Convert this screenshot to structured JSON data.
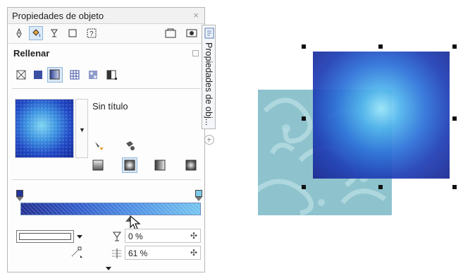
{
  "panel": {
    "title": "Propiedades de objeto",
    "close_glyph": "×",
    "toolbar_icons": [
      "pen-nib-icon",
      "fill-bucket-icon",
      "transparency-glass-icon",
      "frame-icon",
      "summarize-icon",
      "preview-window-icon",
      "eye-icon"
    ],
    "section_title": "Rellenar",
    "fill_types": [
      "no-fill-icon",
      "uniform-fill-icon",
      "fountain-fill-icon",
      "vector-pattern-icon",
      "bitmap-pattern-icon",
      "two-color-pattern-icon"
    ],
    "fill_name": "Sin título",
    "transparency_value": "0 %",
    "smoothness_value": "61 %",
    "side_tab_label": "Propiedades de obj...",
    "colors": {
      "accent": "#2a59c7",
      "gradient_start": "#1d2b8f",
      "gradient_end": "#72c4ee",
      "pattern": "#8ec3cd"
    }
  }
}
